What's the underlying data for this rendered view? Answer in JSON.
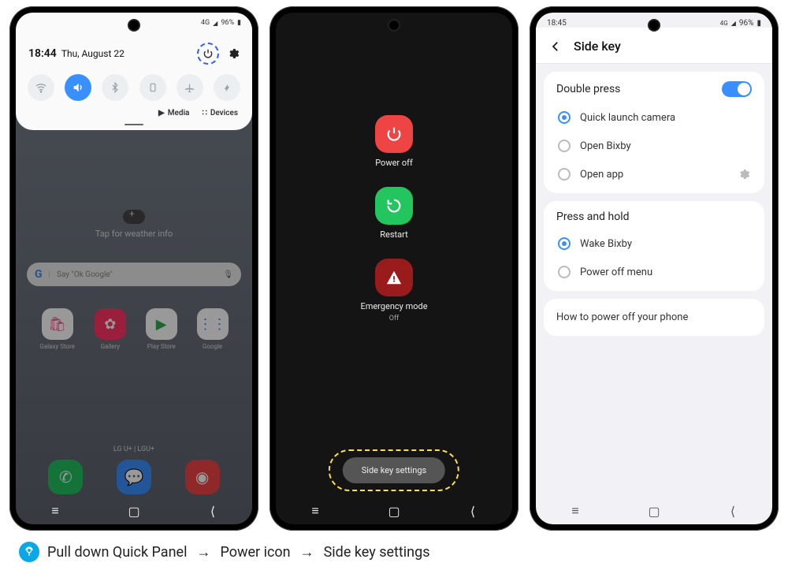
{
  "phone1": {
    "status": {
      "network": "4G",
      "signal": "▮",
      "battery": "96%"
    },
    "time": "18:44",
    "date": "Thu, August 22",
    "toggles": [
      {
        "name": "wifi",
        "glyph": "wifi",
        "on": false
      },
      {
        "name": "sound",
        "glyph": "volume",
        "on": true
      },
      {
        "name": "bluetooth",
        "glyph": "bt",
        "on": false
      },
      {
        "name": "rotation",
        "glyph": "rotate",
        "on": false
      },
      {
        "name": "airplane",
        "glyph": "plane",
        "on": false
      },
      {
        "name": "flashlight",
        "glyph": "flash",
        "on": false
      }
    ],
    "media_label": "Media",
    "devices_label": "Devices",
    "weather_tap": "Tap for weather info",
    "search_hint": "Say \"Ok Google\"",
    "apps": [
      {
        "label": "Galaxy Store",
        "bg": "#fff",
        "fg": "#ff4785",
        "glyph": "bag"
      },
      {
        "label": "Gallery",
        "bg": "#ff3366",
        "fg": "#fff",
        "glyph": "flower"
      },
      {
        "label": "Play Store",
        "bg": "#fff",
        "fg": "#34a853",
        "glyph": "play"
      },
      {
        "label": "Google",
        "bg": "#fff",
        "fg": "#4285F4",
        "glyph": "dots"
      }
    ],
    "dock": [
      {
        "bg": "#1fbf5f",
        "fg": "#fff",
        "glyph": "phone"
      },
      {
        "bg": "#3a8fff",
        "fg": "#fff",
        "glyph": "chat"
      },
      {
        "bg": "#ef4444",
        "fg": "#fff",
        "glyph": "camera"
      }
    ],
    "carrier": "LG U+ | LGU+"
  },
  "phone2": {
    "items": [
      {
        "label": "Power off",
        "color": "red",
        "icon": "power"
      },
      {
        "label": "Restart",
        "color": "green",
        "icon": "restart"
      },
      {
        "label": "Emergency mode",
        "sub": "Off",
        "color": "dark",
        "icon": "alert"
      }
    ],
    "side_key_btn": "Side key settings"
  },
  "phone3": {
    "status": {
      "time": "18:45",
      "battery": "96%",
      "network": "4G"
    },
    "title": "Side key",
    "section1": {
      "title": "Double press",
      "options": [
        {
          "label": "Quick launch camera",
          "checked": true,
          "gear": false
        },
        {
          "label": "Open Bixby",
          "checked": false,
          "gear": false
        },
        {
          "label": "Open app",
          "checked": false,
          "gear": true
        }
      ]
    },
    "section2": {
      "title": "Press and hold",
      "options": [
        {
          "label": "Wake Bixby",
          "checked": true
        },
        {
          "label": "Power off menu",
          "checked": false
        }
      ]
    },
    "how_to": "How to power off your phone"
  },
  "caption": {
    "step1": "Pull down Quick Panel",
    "step2": "Power icon",
    "step3": "Side key settings"
  }
}
